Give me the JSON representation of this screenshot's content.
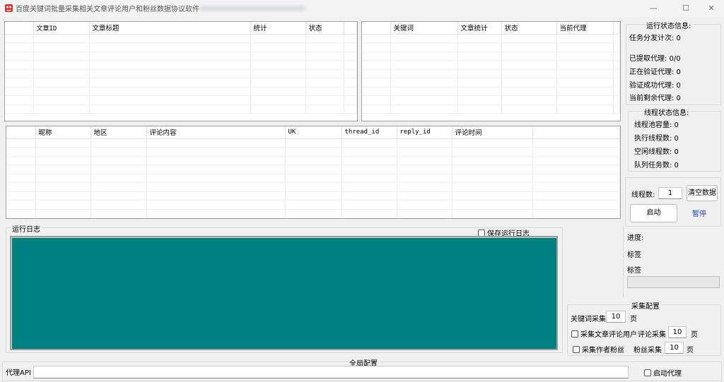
{
  "window": {
    "title": "百度关键词批量采集相关文章评论用户和粉丝数据协议软件",
    "minimize": "—",
    "maximize": "☐",
    "close": "✕"
  },
  "article_table": {
    "headers": [
      "文章ID",
      "文章标题",
      "统计",
      "状态"
    ]
  },
  "keyword_table": {
    "headers": [
      "关键词",
      "文章统计",
      "状态",
      "当前代理"
    ]
  },
  "comment_table": {
    "headers": [
      "昵称",
      "地区",
      "评论内容",
      "UK",
      "thread_id",
      "reply_id",
      "评论时间"
    ]
  },
  "log": {
    "title": "运行日志",
    "save_label": "保存运行日志",
    "save_checked": false,
    "bg_color": "#008080"
  },
  "run_status": {
    "title": "运行状态信息:",
    "task_sent": "任务分发计次: 0",
    "extracted": "已提取代理: 0/0",
    "verifying": "正在验证代理: 0",
    "verified": "验证成功代理: 0",
    "remaining": "当前剩余代理: 0"
  },
  "thread_status": {
    "title": "线程状态信息:",
    "pool": "线程池容量: 0",
    "running": "执行线程数: 0",
    "idle": "空闲线程数: 0",
    "queue": "队列任务数: 0"
  },
  "controls": {
    "thread_label": "线程数:",
    "thread_value": "1",
    "clear_button": "清空数据",
    "start_button": "启动",
    "pause_button": "暂停"
  },
  "progress": {
    "label": "进度:",
    "tag1": "标签",
    "tag2": "标签",
    "value": 0
  },
  "collect_config": {
    "title": "采集配置",
    "keyword_label": "关键词采集",
    "keyword_pages": "10",
    "page_unit": "页",
    "comment_users_label": "采集文章评论用户",
    "comment_users_checked": false,
    "comment_label": "评论采集",
    "comment_pages": "10",
    "author_fans_label": "采集作者粉丝",
    "author_fans_checked": false,
    "fans_label": "粉丝采集",
    "fans_pages": "10"
  },
  "global_config": {
    "title": "全局配置",
    "proxy_api_label": "代理API",
    "proxy_api_value": "",
    "enable_proxy_label": "启动代理",
    "enable_proxy_checked": false
  }
}
